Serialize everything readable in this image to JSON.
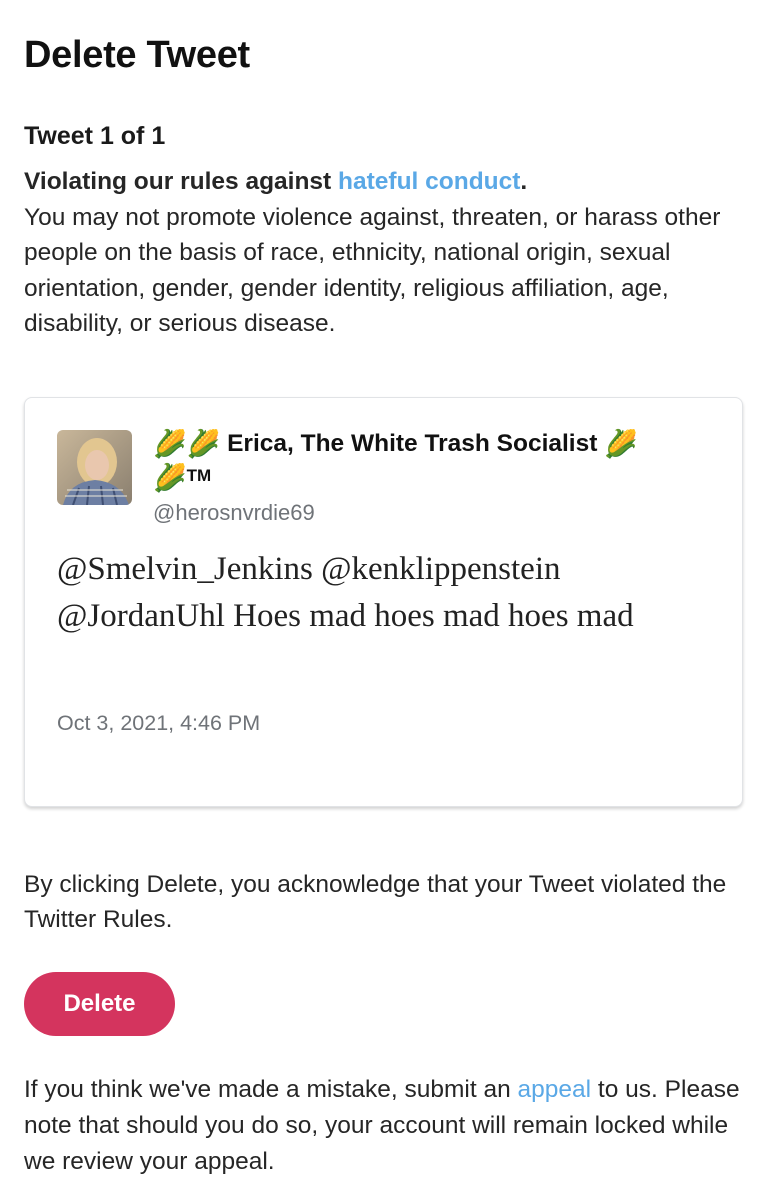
{
  "header": {
    "title": "Delete Tweet"
  },
  "notice": {
    "tweet_count": "Tweet 1 of 1",
    "rule_prefix": "Violating our rules against ",
    "rule_link": "hateful conduct",
    "rule_suffix": ".",
    "rule_description": "You may not promote violence against, threaten, or harass other people on the basis of race, ethnicity, national origin, sexual orientation, gender, gender identity, religious affiliation, age, disability, or serious disease."
  },
  "tweet": {
    "author_emoji": "🌽",
    "author_name": "Erica, The White Trash Socialist",
    "author_tm": "TM",
    "handle": "@herosnvrdie69",
    "text": "@Smelvin_Jenkins @kenklippenstein @JordanUhl Hoes mad hoes mad hoes mad",
    "date": "Oct 3, 2021, 4:46 PM"
  },
  "acknowledgement": {
    "text": "By clicking Delete, you acknowledge that your Tweet violated the Twitter Rules."
  },
  "actions": {
    "delete_label": "Delete"
  },
  "appeal": {
    "prefix": "If you think we've made a mistake, submit an ",
    "link": "appeal",
    "suffix": " to us. Please note that should you do so, your account will remain locked while we review your appeal."
  },
  "colors": {
    "link": "#5aa8e6",
    "delete_button": "#d4345e",
    "secondary_text": "#6f7378"
  }
}
